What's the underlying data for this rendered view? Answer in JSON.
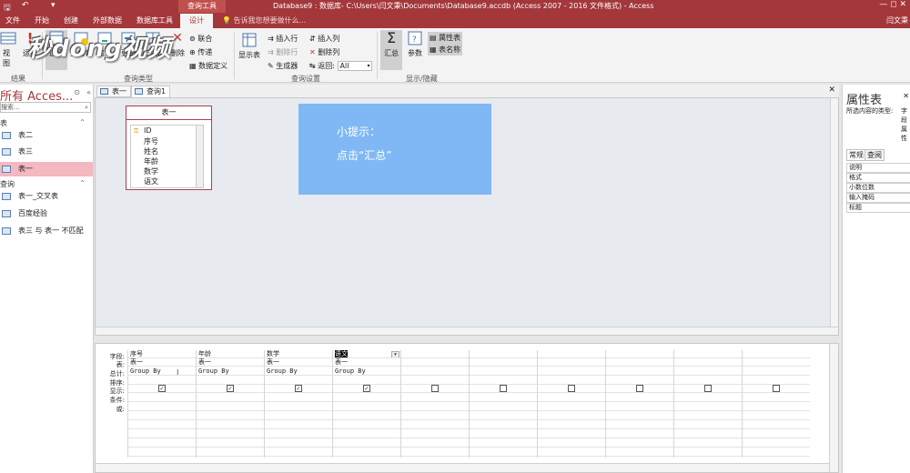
{
  "titlebar": {
    "context_tab": "查询工具",
    "title": "Database9 : 数据库- C:\\Users\\闫文秉\\Documents\\Database9.accdb (Access 2007 - 2016 文件格式) - Access",
    "window_controls": "—  ◻  ✕"
  },
  "tabs": [
    "文件",
    "开始",
    "创建",
    "外部数据",
    "数据库工具",
    "设计"
  ],
  "tell_me": "告诉我您想要做什么...",
  "user": "闫文秉",
  "watermark": "秒dong视频",
  "ribbon": {
    "results": {
      "view": "视图",
      "run": "运行",
      "group": "结果"
    },
    "query_type": {
      "select": "选择",
      "make_table": "生成表",
      "append": "追加",
      "update": "更新",
      "crosstab": "交叉表",
      "delete": "删除",
      "union": "联合",
      "pass_through": "传递",
      "data_def": "数据定义",
      "group": "查询类型"
    },
    "setup": {
      "show_table": "显示表",
      "insert_rows": "插入行",
      "delete_rows": "删除行",
      "builder": "生成器",
      "insert_cols": "插入列",
      "delete_cols": "删除列",
      "return_label": "返回:",
      "return_value": "All",
      "group": "查询设置"
    },
    "show_hide": {
      "totals": "汇总",
      "params": "参数",
      "prop_sheet": "属性表",
      "table_names": "表名称",
      "group": "显示/隐藏"
    }
  },
  "nav": {
    "title": "所有 Acces...",
    "search": "搜索...",
    "sections": [
      {
        "label": "表",
        "items": [
          "表二",
          "表三",
          "表一"
        ]
      },
      {
        "label": "查询",
        "items": [
          "表一_交叉表",
          "百度经验",
          "表三 与 表一 不匹配"
        ]
      }
    ]
  },
  "doc_tabs": [
    "表一",
    "查询1"
  ],
  "table_box": {
    "name": "表一",
    "fields": [
      "ID",
      "序号",
      "姓名",
      "年龄",
      "数学",
      "语文"
    ]
  },
  "tip": {
    "line1": "小提示：",
    "line2": "点击“汇总”"
  },
  "grid": {
    "row_labels": [
      "字段:",
      "表:",
      "总计:",
      "排序:",
      "显示:",
      "条件:",
      "或:"
    ],
    "columns": [
      {
        "field": "序号",
        "table": "表一",
        "total": "Group By",
        "show": true
      },
      {
        "field": "年龄",
        "table": "表一",
        "total": "Group By",
        "show": true
      },
      {
        "field": "数学",
        "table": "表一",
        "total": "Group By",
        "show": true
      },
      {
        "field": "语文",
        "table": "表一",
        "total": "Group By",
        "show": true
      },
      {
        "field": "",
        "table": "",
        "total": "",
        "show": false
      },
      {
        "field": "",
        "table": "",
        "total": "",
        "show": false
      },
      {
        "field": "",
        "table": "",
        "total": "",
        "show": false
      },
      {
        "field": "",
        "table": "",
        "total": "",
        "show": false
      },
      {
        "field": "",
        "table": "",
        "total": "",
        "show": false
      },
      {
        "field": "",
        "table": "",
        "total": "",
        "show": false
      }
    ]
  },
  "props": {
    "title": "属性表",
    "type_label": "所选内容的类型:",
    "type_value": "字段属性",
    "tabs": [
      "常规",
      "查阅"
    ],
    "rows": [
      "说明",
      "格式",
      "小数位数",
      "输入掩码",
      "标题"
    ]
  },
  "colors": {
    "accent": "#a4373a",
    "tip": "#7fb8f4",
    "active_nav": "#f4b8c1"
  }
}
